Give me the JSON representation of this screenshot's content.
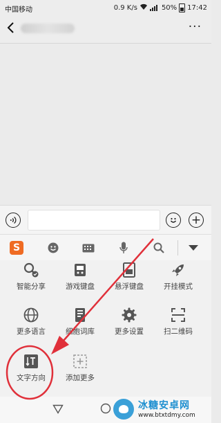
{
  "status_bar": {
    "carrier": "中国移动",
    "speed": "0.9 K/s",
    "battery": "50%",
    "time": "17:42"
  },
  "nav": {
    "back_icon": "chevron-left-icon",
    "more_label": "···"
  },
  "input_bar": {
    "voice_icon": "voice-icon",
    "emoji_icon": "smiley-icon",
    "plus_label": "+"
  },
  "ime_toolbar": {
    "logo_label": "S",
    "icons": [
      "emoji-icon",
      "keyboard-icon",
      "microphone-icon",
      "search-icon"
    ]
  },
  "panel": {
    "items": [
      {
        "label": "智能分享",
        "icon": "smart-share-icon"
      },
      {
        "label": "游戏键盘",
        "icon": "game-keyboard-icon"
      },
      {
        "label": "悬浮键盘",
        "icon": "floating-keyboard-icon"
      },
      {
        "label": "开挂模式",
        "icon": "rocket-icon"
      },
      {
        "label": "更多语言",
        "icon": "globe-icon"
      },
      {
        "label": "细胞词库",
        "icon": "cell-dictionary-icon"
      },
      {
        "label": "更多设置",
        "icon": "gear-icon"
      },
      {
        "label": "扫二维码",
        "icon": "scan-qr-icon"
      },
      {
        "label": "文字方向",
        "icon": "text-direction-icon"
      },
      {
        "label": "添加更多",
        "icon": "add-more-icon"
      }
    ]
  },
  "watermark": {
    "title": "冰糖安卓网",
    "url": "www.btxtdmy.com"
  },
  "colors": {
    "sogou_orange": "#ef6b23",
    "annotation_red": "#e0303a",
    "watermark_blue": "#1e8fd0"
  }
}
